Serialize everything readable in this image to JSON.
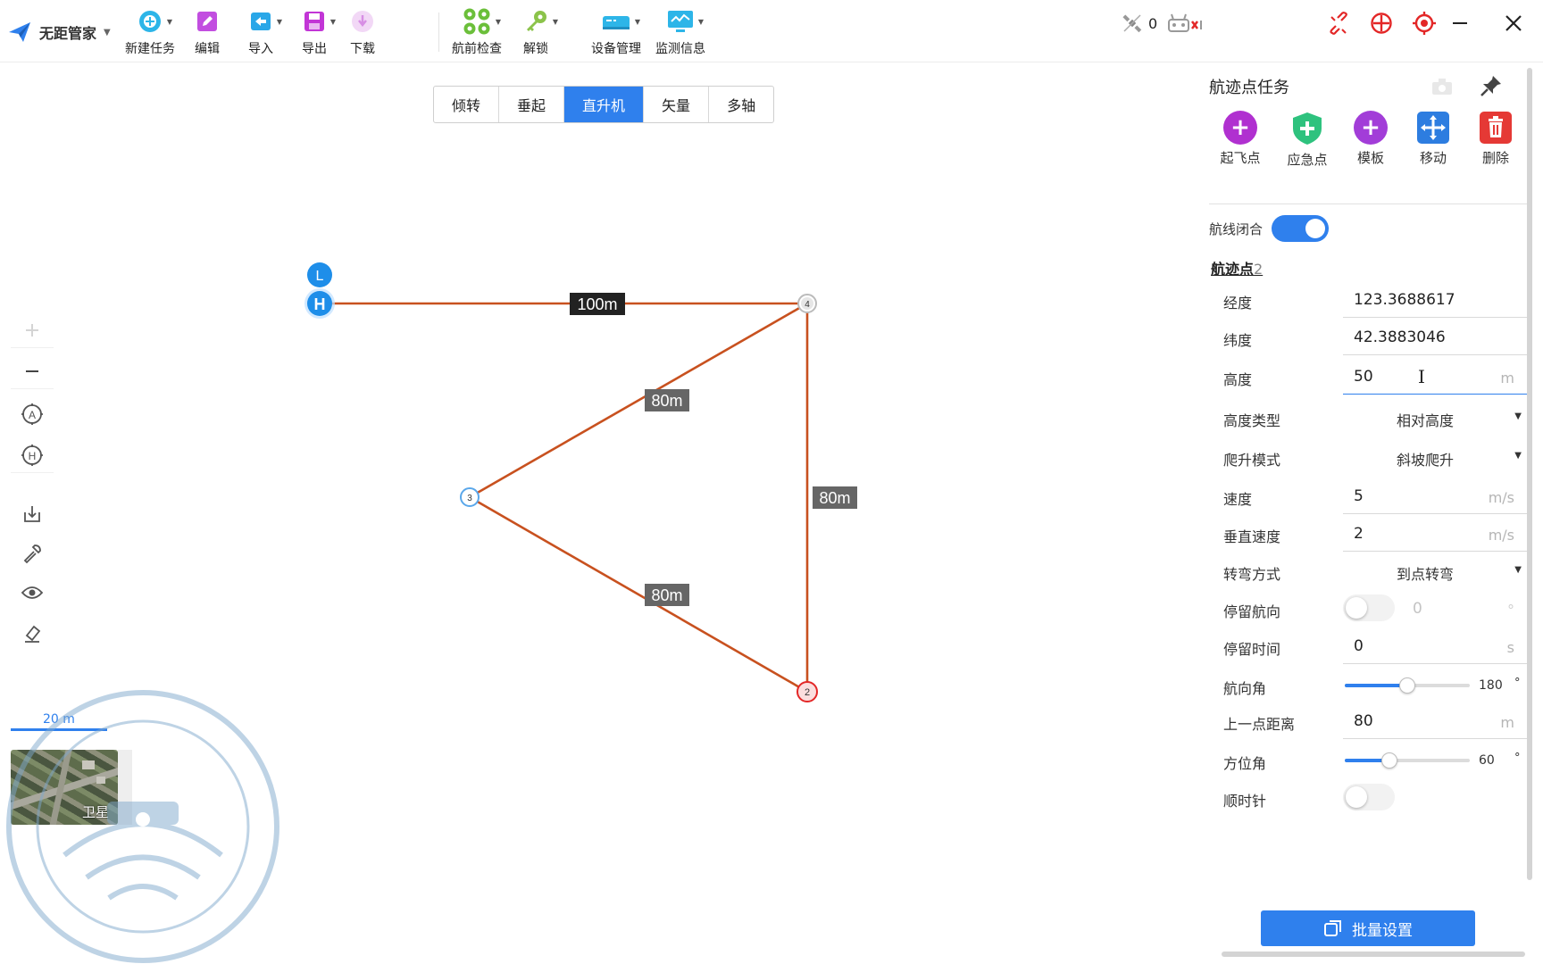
{
  "app": {
    "title": "无距管家"
  },
  "toolbar": {
    "new_task": "新建任务",
    "edit": "编辑",
    "import": "导入",
    "export": "导出",
    "download": "下载",
    "preflight": "航前检查",
    "unlock": "解锁",
    "device": "设备管理",
    "monitor": "监测信息"
  },
  "status": {
    "satellites": "0"
  },
  "map": {
    "aircraft_tabs": [
      "倾转",
      "垂起",
      "直升机",
      "矢量",
      "多轴"
    ],
    "active_tab": "直升机",
    "markers": {
      "launch": "L",
      "home": "H",
      "wp4": "4",
      "wp3": "3",
      "wp2": "2"
    },
    "distances": {
      "h_to_4": "100m",
      "4_to_3": "80m",
      "4_to_2": "80m",
      "3_to_2": "80m"
    },
    "scale_label": "20 m",
    "basemap_label": "卫星"
  },
  "panel": {
    "title": "航迹点任务",
    "actions": {
      "takeoff": "起飞点",
      "emergency": "应急点",
      "template": "模板",
      "move": "移动",
      "delete": "删除"
    },
    "route_closed_label": "航线闭合",
    "route_closed": true,
    "waypoint_label": "航迹点",
    "waypoint_index": "2",
    "fields": {
      "longitude": {
        "label": "经度",
        "value": "123.3688617"
      },
      "latitude": {
        "label": "纬度",
        "value": "42.3883046"
      },
      "altitude": {
        "label": "高度",
        "value": "50",
        "unit": "m"
      },
      "altitude_type": {
        "label": "高度类型",
        "value": "相对高度"
      },
      "climb_mode": {
        "label": "爬升模式",
        "value": "斜坡爬升"
      },
      "speed": {
        "label": "速度",
        "value": "5",
        "unit": "m/s"
      },
      "vertical_speed": {
        "label": "垂直速度",
        "value": "2",
        "unit": "m/s"
      },
      "turn_mode": {
        "label": "转弯方式",
        "value": "到点转弯"
      },
      "hold_heading": {
        "label": "停留航向",
        "value": "0",
        "unit": "°",
        "enabled": false
      },
      "hold_time": {
        "label": "停留时间",
        "value": "0",
        "unit": "s"
      },
      "heading": {
        "label": "航向角",
        "value": "180",
        "unit": "°",
        "fraction": 0.5
      },
      "prev_distance": {
        "label": "上一点距离",
        "value": "80",
        "unit": "m"
      },
      "azimuth": {
        "label": "方位角",
        "value": "60",
        "unit": "°",
        "fraction": 0.36
      },
      "clockwise": {
        "label": "顺时针",
        "enabled": false
      }
    },
    "batch_button": "批量设置"
  },
  "colors": {
    "accent": "#2f80ed",
    "route": "#c8511f",
    "takeoff": "#b030d0",
    "emergency": "#2ec27e",
    "template": "#a23dd8",
    "move": "#2d7de0",
    "delete": "#e53935",
    "toolbar_red": "#e32727"
  }
}
